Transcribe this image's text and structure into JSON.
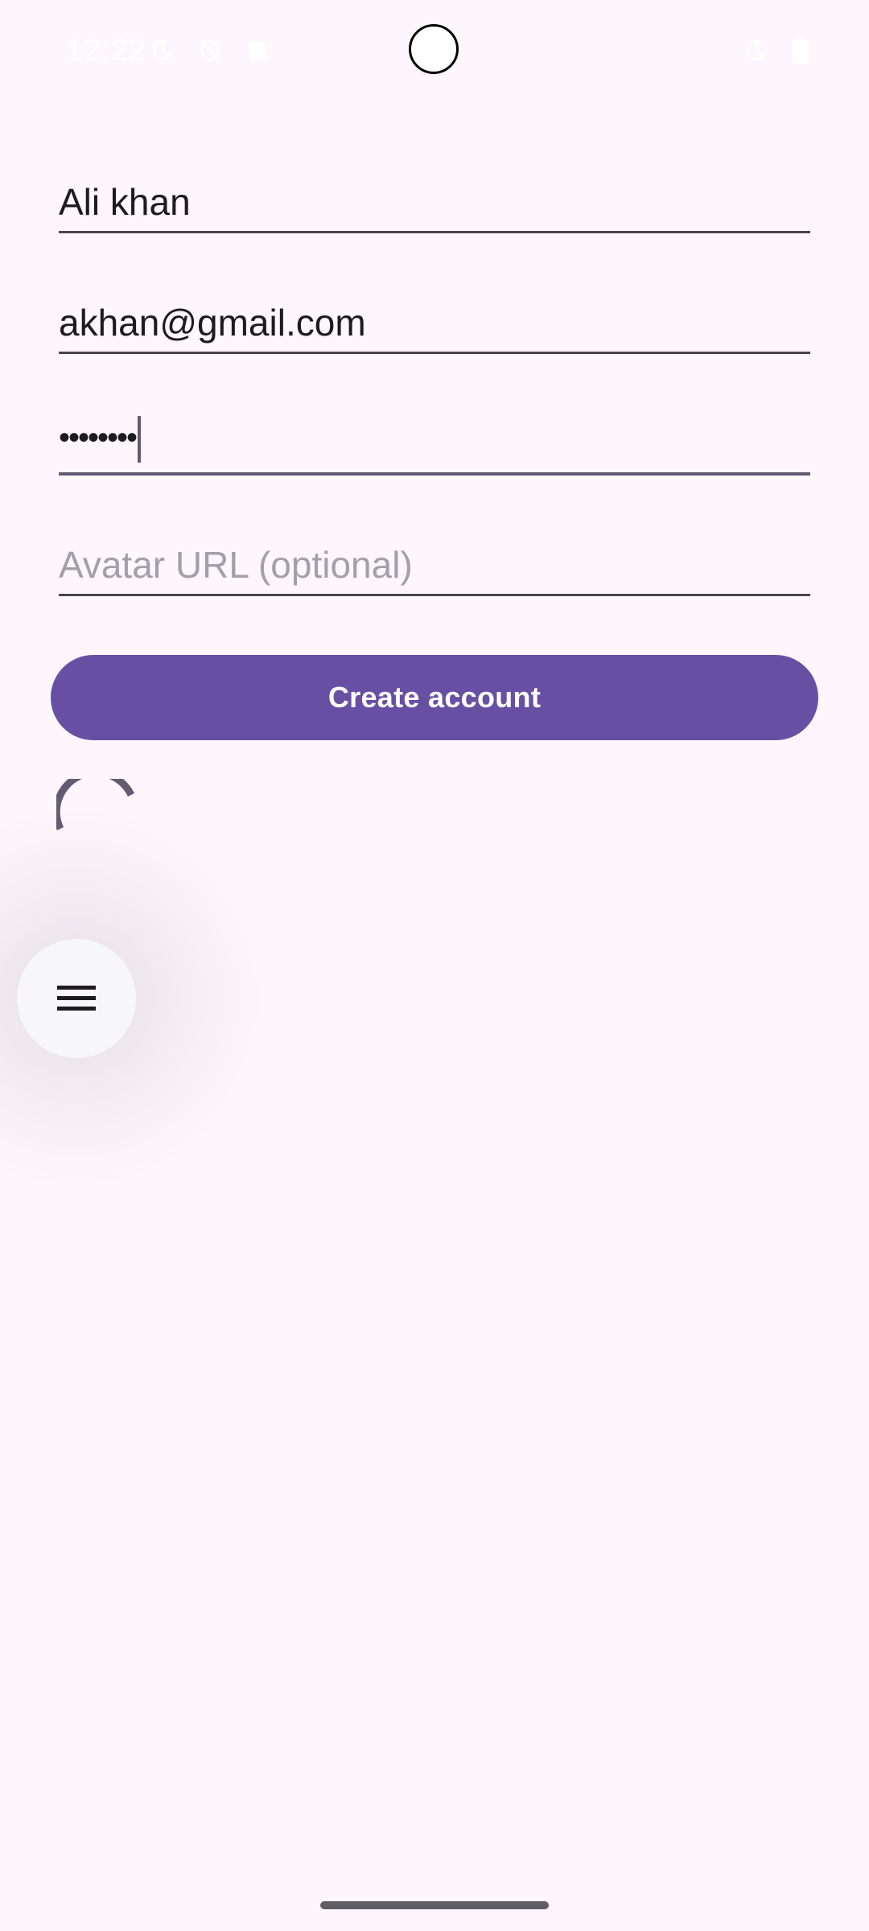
{
  "status_bar": {
    "time": "12:22",
    "icons": [
      "moon-icon",
      "shield-off-icon",
      "sim-card-icon",
      "moon-icon",
      "battery-icon"
    ]
  },
  "form": {
    "name_value": "Ali khan",
    "email_value": "akhan@gmail.com",
    "password_masked": "••••••••",
    "avatar_placeholder": "Avatar URL (optional)",
    "submit_label": "Create account"
  },
  "fab": {
    "icon": "menu-icon"
  },
  "colors": {
    "background": "#fdf6fc",
    "primary": "#6750a4",
    "on_surface": "#1d1b20",
    "outline": "#49454f",
    "placeholder": "#a39fa8"
  }
}
